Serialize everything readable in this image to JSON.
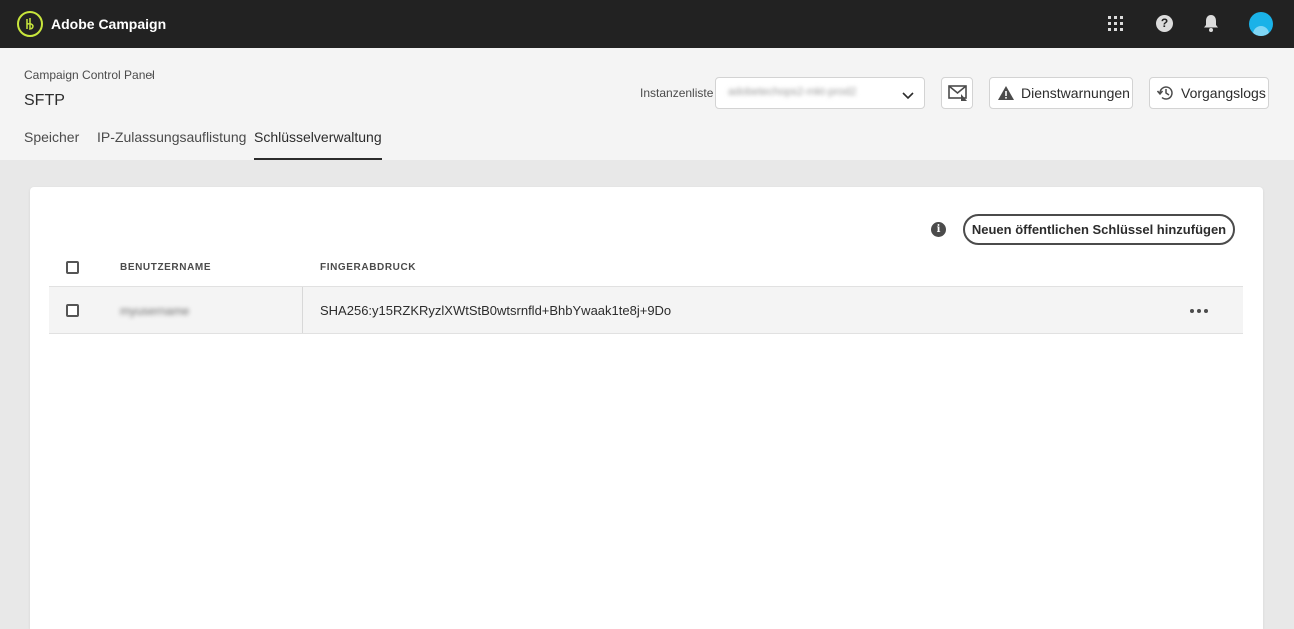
{
  "topbar": {
    "app_title": "Adobe Campaign",
    "icons": [
      "adobe-campaign-logo-icon",
      "apps-grid-icon",
      "help-icon",
      "bell-icon",
      "avatar"
    ],
    "help_glyph": "?"
  },
  "header": {
    "breadcrumb": "Campaign Control Panel",
    "breadcrumb_separator": "›",
    "title": "SFTP",
    "tabs": [
      {
        "label": "Speicher",
        "active": false
      },
      {
        "label": "IP-Zulassungsauflistung",
        "active": false
      },
      {
        "label": "Schlüsselverwaltung",
        "active": true
      }
    ],
    "instance_label": "Instanzenliste",
    "instance_value": "adobetechops2-mkt-prod2",
    "service_alerts_label": "Dienstwarnungen",
    "job_logs_label": "Vorgangslogs"
  },
  "card": {
    "add_key_label": "Neuen öffentlichen Schlüssel hinzufügen",
    "info_glyph": "i",
    "columns": [
      "BENUTZERNAME",
      "FINGERABDRUCK"
    ],
    "rows": [
      {
        "username": "myusername",
        "fingerprint": "SHA256:y15RZKRyzlXWtStB0wtsrnfld+BhbYwaak1te8j+9Do",
        "checked": false
      }
    ]
  },
  "colors": {
    "topbar_bg": "#222222",
    "logo_accent": "#c8e63c",
    "avatar": "#1ab2e8",
    "header_bg": "#f4f4f4",
    "page_bg": "#e8e8e8"
  }
}
